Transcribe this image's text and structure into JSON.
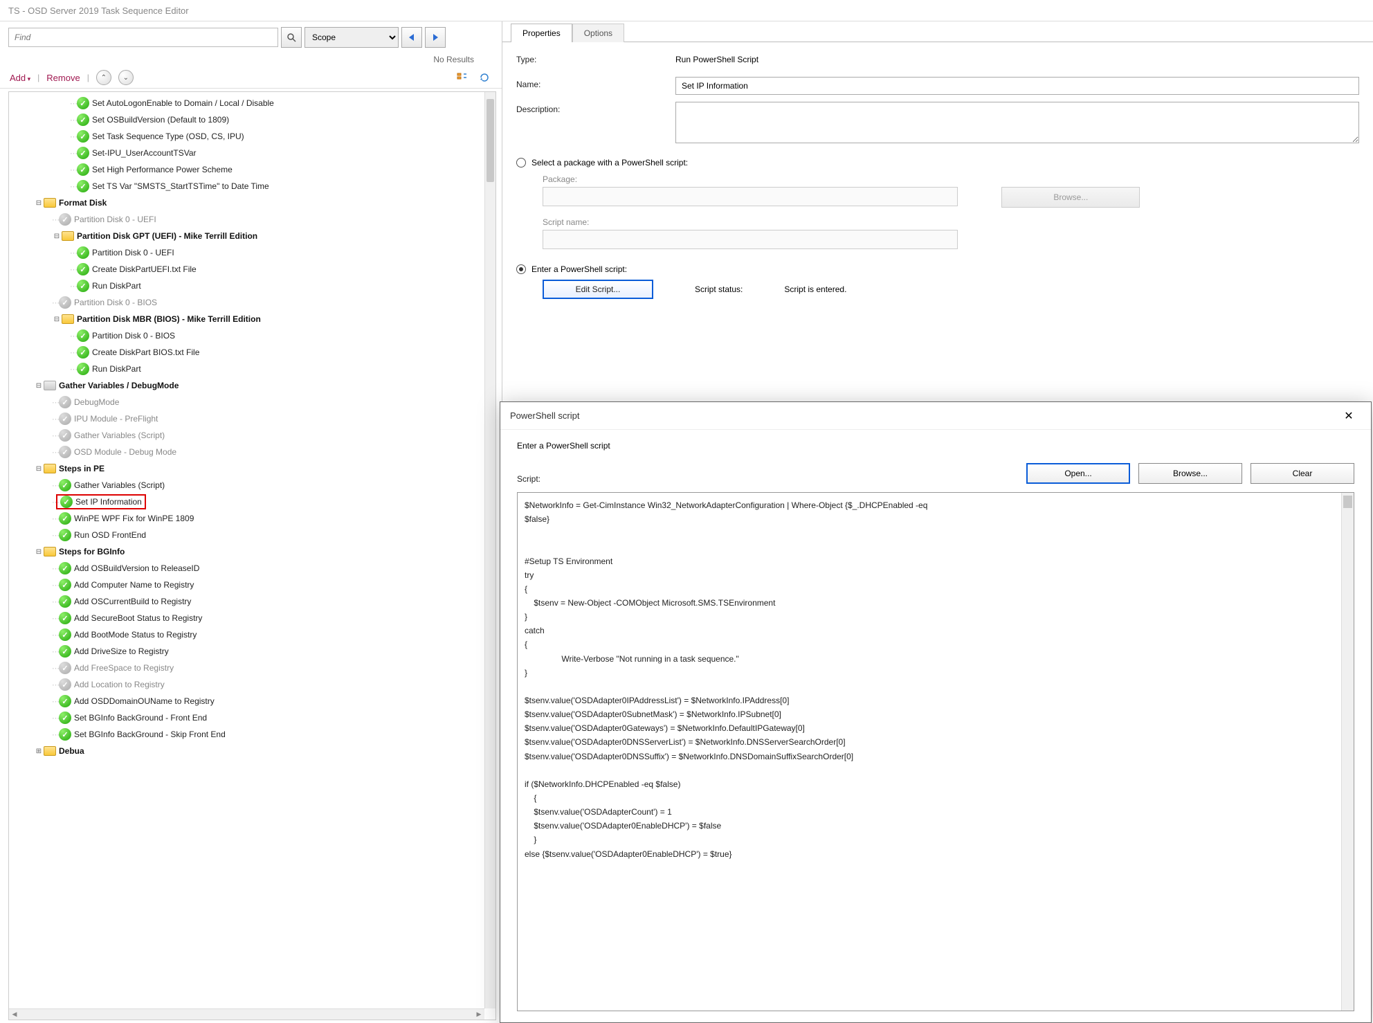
{
  "window": {
    "title": "TS - OSD Server 2019 Task Sequence Editor"
  },
  "search": {
    "placeholder": "Find",
    "no_results": "No Results",
    "scope": "Scope"
  },
  "toolbar": {
    "add": "Add",
    "remove": "Remove"
  },
  "tree": [
    {
      "d": 3,
      "t": "check",
      "lbl": "Set AutoLogonEnable to Domain / Local / Disable"
    },
    {
      "d": 3,
      "t": "check",
      "lbl": "Set OSBuildVersion (Default to 1809)"
    },
    {
      "d": 3,
      "t": "check",
      "lbl": "Set Task Sequence Type (OSD, CS, IPU)"
    },
    {
      "d": 3,
      "t": "check",
      "lbl": "Set-IPU_UserAccountTSVar"
    },
    {
      "d": 3,
      "t": "check",
      "lbl": "Set High Performance Power Scheme"
    },
    {
      "d": 3,
      "t": "check",
      "lbl": "Set TS Var \"SMSTS_StartTSTime\" to Date Time"
    },
    {
      "d": 1,
      "t": "folder",
      "lbl": "Format Disk",
      "bold": true,
      "exp": "open"
    },
    {
      "d": 2,
      "t": "grey",
      "lbl": "Partition Disk 0 - UEFI",
      "g": true
    },
    {
      "d": 2,
      "t": "folder",
      "lbl": "Partition Disk GPT (UEFI) - Mike Terrill Edition",
      "bold": true,
      "exp": "open"
    },
    {
      "d": 3,
      "t": "check",
      "lbl": "Partition Disk 0 - UEFI"
    },
    {
      "d": 3,
      "t": "check",
      "lbl": "Create DiskPartUEFI.txt File"
    },
    {
      "d": 3,
      "t": "check",
      "lbl": "Run DiskPart"
    },
    {
      "d": 2,
      "t": "grey",
      "lbl": "Partition Disk 0 - BIOS",
      "g": true
    },
    {
      "d": 2,
      "t": "folder",
      "lbl": "Partition Disk MBR (BIOS) - Mike Terrill Edition",
      "bold": true,
      "exp": "open"
    },
    {
      "d": 3,
      "t": "check",
      "lbl": "Partition Disk 0 - BIOS"
    },
    {
      "d": 3,
      "t": "check",
      "lbl": "Create DiskPart BIOS.txt File"
    },
    {
      "d": 3,
      "t": "check",
      "lbl": "Run DiskPart"
    },
    {
      "d": 1,
      "t": "folderg",
      "lbl": "Gather Variables / DebugMode",
      "bold": true,
      "g": true,
      "exp": "open"
    },
    {
      "d": 2,
      "t": "grey",
      "lbl": "DebugMode",
      "g": true
    },
    {
      "d": 2,
      "t": "grey",
      "lbl": "IPU Module - PreFlight",
      "g": true
    },
    {
      "d": 2,
      "t": "grey",
      "lbl": "Gather Variables (Script)",
      "g": true
    },
    {
      "d": 2,
      "t": "grey",
      "lbl": "OSD Module - Debug Mode",
      "g": true
    },
    {
      "d": 1,
      "t": "folder",
      "lbl": "Steps in PE",
      "bold": true,
      "exp": "open"
    },
    {
      "d": 2,
      "t": "check",
      "lbl": "Gather Variables (Script)"
    },
    {
      "d": 2,
      "t": "check",
      "lbl": "Set IP Information",
      "hl": true
    },
    {
      "d": 2,
      "t": "check",
      "lbl": "WinPE WPF Fix for WinPE 1809"
    },
    {
      "d": 2,
      "t": "check",
      "lbl": "Run OSD FrontEnd"
    },
    {
      "d": 1,
      "t": "folder",
      "lbl": "Steps for  BGInfo",
      "bold": true,
      "exp": "open"
    },
    {
      "d": 2,
      "t": "check",
      "lbl": "Add OSBuildVersion to ReleaseID"
    },
    {
      "d": 2,
      "t": "check",
      "lbl": "Add Computer Name to Registry"
    },
    {
      "d": 2,
      "t": "check",
      "lbl": "Add OSCurrentBuild to Registry"
    },
    {
      "d": 2,
      "t": "check",
      "lbl": "Add SecureBoot Status to Registry"
    },
    {
      "d": 2,
      "t": "check",
      "lbl": "Add BootMode Status to Registry"
    },
    {
      "d": 2,
      "t": "check",
      "lbl": "Add DriveSize to Registry"
    },
    {
      "d": 2,
      "t": "grey",
      "lbl": "Add FreeSpace to Registry",
      "g": true
    },
    {
      "d": 2,
      "t": "grey",
      "lbl": "Add Location to Registry",
      "g": true
    },
    {
      "d": 2,
      "t": "check",
      "lbl": "Add OSDDomainOUName to Registry"
    },
    {
      "d": 2,
      "t": "check",
      "lbl": "Set BGInfo BackGround - Front End"
    },
    {
      "d": 2,
      "t": "check",
      "lbl": "Set BGInfo BackGround - Skip Front End"
    },
    {
      "d": 1,
      "t": "folder",
      "lbl": "Debua",
      "bold": true,
      "exp": "closed"
    }
  ],
  "props": {
    "tab_properties": "Properties",
    "tab_options": "Options",
    "type_lbl": "Type:",
    "type_val": "Run PowerShell Script",
    "name_lbl": "Name:",
    "name_val": "Set IP Information",
    "desc_lbl": "Description:",
    "radio_pkg": "Select a package with a PowerShell script:",
    "pkg_lbl": "Package:",
    "browse": "Browse...",
    "scriptname_lbl": "Script name:",
    "radio_enter": "Enter a PowerShell script:",
    "edit_script": "Edit Script...",
    "status_lbl": "Script status:",
    "status_val": "Script is entered."
  },
  "dialog": {
    "title": "PowerShell script",
    "subtitle": "Enter a PowerShell script",
    "open": "Open...",
    "browse": "Browse...",
    "clear": "Clear",
    "script_lbl": "Script:",
    "script": "$NetworkInfo = Get-CimInstance Win32_NetworkAdapterConfiguration | Where-Object {$_.DHCPEnabled -eq\n$false}\n\n\n#Setup TS Environment\ntry\n{\n    $tsenv = New-Object -COMObject Microsoft.SMS.TSEnvironment\n}\ncatch\n{\n                Write-Verbose \"Not running in a task sequence.\"\n}\n\n$tsenv.value('OSDAdapter0IPAddressList') = $NetworkInfo.IPAddress[0]\n$tsenv.value('OSDAdapter0SubnetMask') = $NetworkInfo.IPSubnet[0]\n$tsenv.value('OSDAdapter0Gateways') = $NetworkInfo.DefaultIPGateway[0]\n$tsenv.value('OSDAdapter0DNSServerList') = $NetworkInfo.DNSServerSearchOrder[0]\n$tsenv.value('OSDAdapter0DNSSuffix') = $NetworkInfo.DNSDomainSuffixSearchOrder[0]\n\nif ($NetworkInfo.DHCPEnabled -eq $false)\n    {\n    $tsenv.value('OSDAdapterCount') = 1\n    $tsenv.value('OSDAdapter0EnableDHCP') = $false\n    }\nelse {$tsenv.value('OSDAdapter0EnableDHCP') = $true}"
  }
}
